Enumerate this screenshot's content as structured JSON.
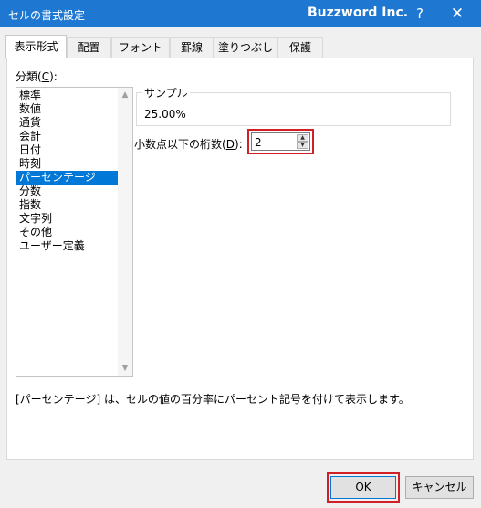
{
  "window": {
    "title": "セルの書式設定",
    "brand": "Buzzword Inc.",
    "help_label": "?",
    "close_label": "✕"
  },
  "tabs": [
    {
      "label": "表示形式",
      "active": true
    },
    {
      "label": "配置"
    },
    {
      "label": "フォント"
    },
    {
      "label": "罫線"
    },
    {
      "label": "塗りつぶし"
    },
    {
      "label": "保護"
    }
  ],
  "category": {
    "label_prefix": "分類(",
    "label_key": "C",
    "label_suffix": "):",
    "items": [
      "標準",
      "数値",
      "通貨",
      "会計",
      "日付",
      "時刻",
      "パーセンテージ",
      "分数",
      "指数",
      "文字列",
      "その他",
      "ユーザー定義"
    ],
    "selected": "パーセンテージ"
  },
  "sample": {
    "legend": "サンプル",
    "value": "25.00%"
  },
  "decimal": {
    "label_prefix": "小数点以下の桁数(",
    "label_key": "D",
    "label_suffix": "):",
    "value": "2"
  },
  "description": "[パーセンテージ] は、セルの値の百分率にパーセント記号を付けて表示します。",
  "buttons": {
    "ok": "OK",
    "cancel": "キャンセル"
  },
  "colors": {
    "titlebar": "#1e78d2",
    "selection": "#0078d7",
    "highlight_border": "#d12025"
  }
}
